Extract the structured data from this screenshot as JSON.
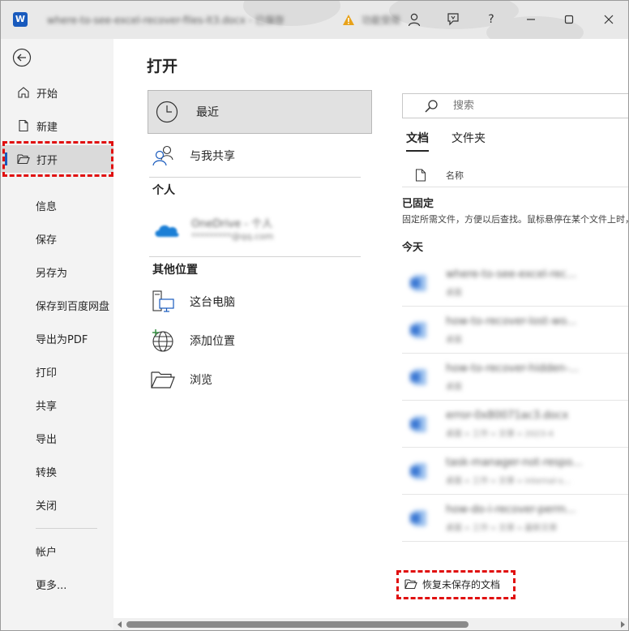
{
  "titlebar": {
    "app_logo": "W",
    "doc_title": "where-to-see-excel-recover-files-lt3.docx - 已保存",
    "warning_text": "功能受限",
    "icons": [
      "word-logo-icon",
      "warning-icon",
      "account-icon",
      "comments-icon",
      "help-icon",
      "minimize-icon",
      "maximize-icon",
      "close-icon"
    ],
    "help_label": "?"
  },
  "nav": {
    "primary": [
      {
        "label": "开始",
        "icon": "home-icon"
      },
      {
        "label": "新建",
        "icon": "new-document-icon"
      },
      {
        "label": "打开",
        "icon": "open-folder-icon",
        "active": true
      }
    ],
    "secondary": [
      "信息",
      "保存",
      "另存为",
      "保存到百度网盘",
      "导出为PDF",
      "打印",
      "共享",
      "导出",
      "转换",
      "关闭"
    ],
    "footer": [
      "帐户",
      "更多..."
    ]
  },
  "main": {
    "title": "打开",
    "locations": {
      "recent": "最近",
      "shared": "与我共享",
      "personal_heading": "个人",
      "onedrive_name": "OneDrive - 个人",
      "onedrive_email": "*********@qq.com",
      "other_heading": "其他位置",
      "this_pc": "这台电脑",
      "add_place": "添加位置",
      "browse": "浏览"
    },
    "search": {
      "placeholder": "搜索"
    },
    "tabs": [
      {
        "label": "文档",
        "active": true
      },
      {
        "label": "文件夹"
      }
    ],
    "column_name": "名称",
    "pinned_title": "已固定",
    "pinned_desc": "固定所需文件，方便以后查找。鼠标悬停在某个文件上时，单击显示的图钉图标。",
    "today_title": "今天",
    "files": [
      {
        "name": "where-to-see-excel-rec...",
        "path": "桌面"
      },
      {
        "name": "how-to-recover-lost-wo...",
        "path": "桌面"
      },
      {
        "name": "how-to-recover-hidden-...",
        "path": "桌面"
      },
      {
        "name": "error-0x80071ac3.docx",
        "path": "桌面 » 工作 » 文章 » 2023-4"
      },
      {
        "name": "task-manager-not-respo...",
        "path": "桌面 » 工作 » 文章 » internal-s..."
      },
      {
        "name": "how-do-i-recover-perm...",
        "path": "桌面 » 工作 » 文章 » 最新文章"
      }
    ],
    "recover_label": "恢复未保存的文档"
  },
  "colors": {
    "accent": "#185abd",
    "highlight": "#e01010",
    "nav_bg": "#f3f3f3",
    "selected_bg": "#e1e1e1"
  }
}
